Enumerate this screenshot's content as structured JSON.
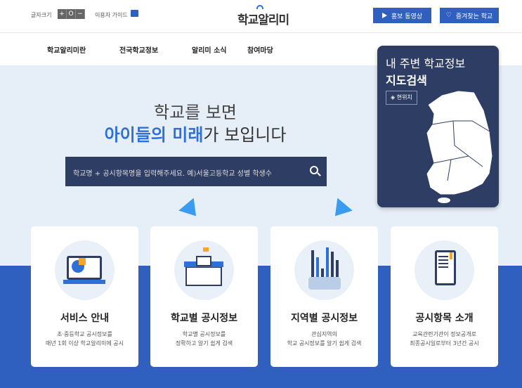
{
  "header": {
    "font_size_label": "글자크기",
    "font_buttons": [
      "+",
      "O",
      "−"
    ],
    "guide_label": "이용자 가이드",
    "logo": "학교알리미",
    "promo_video": "홍보 동영상",
    "favorite_schools": "즐겨찾는 학교"
  },
  "nav": [
    "학교알리미란",
    "전국학교정보",
    "알리미 소식",
    "참여마당"
  ],
  "hero": {
    "line1": "학교를 보면",
    "line2_highlight": "아이들의 미래",
    "line2_rest": "가 보입니다",
    "search_placeholder": "학교명 + 공시항목명을 입력해주세요. 예)서울고등학교 성별 학생수"
  },
  "map_card": {
    "title1": "내 주변 학교정보",
    "title2": "지도검색",
    "location_button": "현위치"
  },
  "cards": [
    {
      "title": "서비스 안내",
      "desc": [
        "초·중등학교 공시정보를",
        "매년 1회 이상 학교알리미에 공시"
      ],
      "icon": "laptop-chart-icon"
    },
    {
      "title": "학교별 공시정보",
      "desc": [
        "학교별 공시정보를",
        "정확하고 알기 쉽게 검색"
      ],
      "icon": "school-building-icon"
    },
    {
      "title": "지역별 공시정보",
      "desc": [
        "관심지역의",
        "학교 공시정보를 알기 쉽게 검색"
      ],
      "icon": "region-bar-chart-icon"
    },
    {
      "title": "공시항목 소개",
      "desc": [
        "교육관련기관이 정보공개로",
        "최종공시일로부터 3년간 공시"
      ],
      "icon": "tablet-document-icon"
    }
  ],
  "colors": {
    "primary": "#2f5fbf",
    "navy": "#2e3d64",
    "hero_bg": "#e6eef8",
    "accent": "#2f6fd8"
  }
}
